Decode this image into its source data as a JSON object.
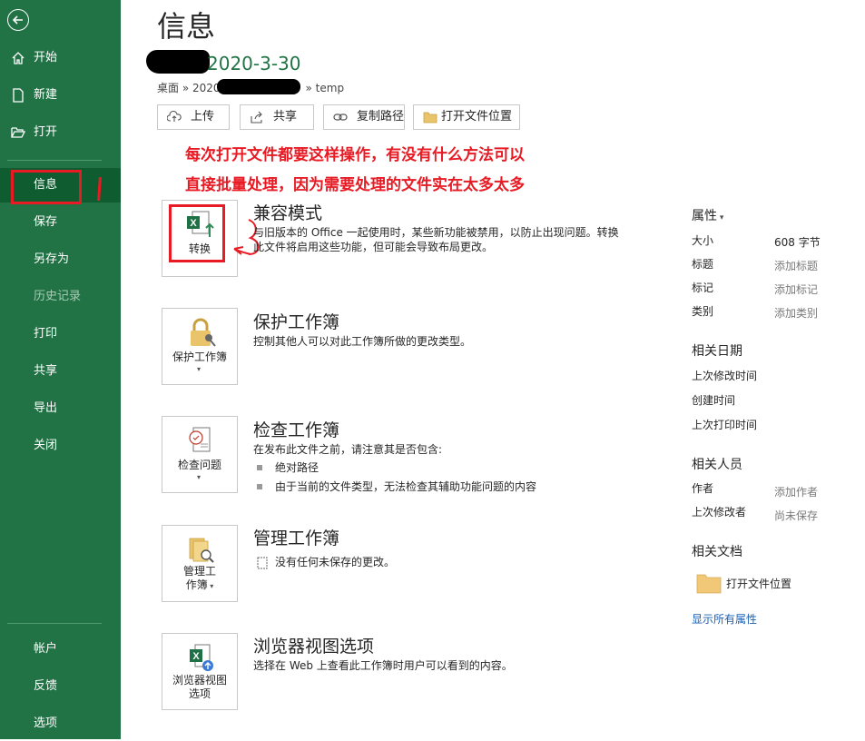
{
  "sidebar": {
    "top_items": [
      {
        "label": "开始",
        "icon": "home-icon"
      },
      {
        "label": "新建",
        "icon": "new-document-icon"
      },
      {
        "label": "打开",
        "icon": "open-folder-icon"
      }
    ],
    "middle_items": [
      {
        "label": "信息",
        "active": true
      },
      {
        "label": "保存"
      },
      {
        "label": "另存为"
      },
      {
        "label": "历史记录",
        "disabled": true
      },
      {
        "label": "打印"
      },
      {
        "label": "共享"
      },
      {
        "label": "导出"
      },
      {
        "label": "关闭"
      }
    ],
    "bottom_items": [
      {
        "label": "帐户"
      },
      {
        "label": "反馈"
      },
      {
        "label": "选项"
      }
    ],
    "color": "#217346",
    "active_color": "#0e5c2f"
  },
  "page": {
    "title": "信息",
    "file_name_visible": "2020-3-30",
    "breadcrumb_start": "桌面 » 2020",
    "breadcrumb_end": "» temp"
  },
  "actions": [
    {
      "label": "上传",
      "icon": "cloud-upload-icon"
    },
    {
      "label": "共享",
      "icon": "share-icon"
    },
    {
      "label": "复制路径",
      "icon": "link-icon"
    },
    {
      "label": "打开文件位置",
      "icon": "folder-icon"
    }
  ],
  "annotation": {
    "line1": "每次打开文件都要这样操作，有没有什么方法可以",
    "line2": "直接批量处理，因为需要处理的文件实在太多太多",
    "color": "#e81a23"
  },
  "sections": {
    "compat": {
      "tile_label": "转换",
      "title": "兼容模式",
      "desc_line1": "与旧版本的 Office 一起使用时，某些新功能被禁用，以防止出现问题。转换",
      "desc_line2": "此文件将启用这些功能，但可能会导致布局更改。"
    },
    "protect": {
      "tile_label": "保护工作簿",
      "title": "保护工作簿",
      "desc": "控制其他人可以对此工作簿所做的更改类型。"
    },
    "inspect": {
      "tile_label": "检查问题",
      "title": "检查工作簿",
      "desc": "在发布此文件之前，请注意其是否包含:",
      "bullets": [
        "绝对路径",
        "由于当前的文件类型，无法检查其辅助功能问题的内容"
      ]
    },
    "manage": {
      "tile_label_line1": "管理工",
      "tile_label_line2": "作簿",
      "title": "管理工作簿",
      "desc": "没有任何未保存的更改。"
    },
    "browser": {
      "tile_label_line1": "浏览器视图",
      "tile_label_line2": "选项",
      "title": "浏览器视图选项",
      "desc": "选择在 Web 上查看此工作簿时用户可以看到的内容。"
    }
  },
  "properties": {
    "header": "属性",
    "rows": [
      {
        "label": "大小",
        "value": "608 字节",
        "muted": false
      },
      {
        "label": "标题",
        "value": "添加标题",
        "muted": true
      },
      {
        "label": "标记",
        "value": "添加标记",
        "muted": true
      },
      {
        "label": "类别",
        "value": "添加类别",
        "muted": true
      }
    ],
    "dates_header": "相关日期",
    "dates": [
      "上次修改时间",
      "创建时间",
      "上次打印时间"
    ],
    "people_header": "相关人员",
    "people": [
      {
        "label": "作者",
        "value": "添加作者"
      },
      {
        "label": "上次修改者",
        "value": "尚未保存"
      }
    ],
    "docs_header": "相关文档",
    "open_location": "打开文件位置",
    "show_all": "显示所有属性"
  }
}
